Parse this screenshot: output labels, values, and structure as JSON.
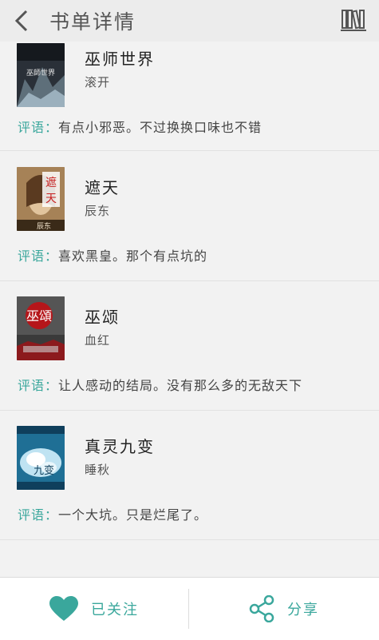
{
  "header": {
    "title": "书单详情"
  },
  "books": [
    {
      "title": "巫师世界",
      "author": "滚开",
      "review_label": "评语：",
      "review": "有点小邪恶。不过换换口味也不错",
      "cover_text": "巫師世界"
    },
    {
      "title": "遮天",
      "author": "辰东",
      "review_label": "评语：",
      "review": "喜欢黑皇。那个有点坑的",
      "cover_text": "遮天"
    },
    {
      "title": "巫颂",
      "author": "血红",
      "review_label": "评语：",
      "review": "让人感动的结局。没有那么多的无敌天下",
      "cover_text": "巫頌"
    },
    {
      "title": "真灵九变",
      "author": "睡秋",
      "review_label": "评语：",
      "review": "一个大坑。只是烂尾了。",
      "cover_text": "九变"
    }
  ],
  "bottom": {
    "follow_label": "已关注",
    "share_label": "分享"
  },
  "colors": {
    "accent": "#3aa79c"
  },
  "icons": {
    "back": "chevron-left",
    "bookshelf": "bookshelf",
    "follow": "heart",
    "share": "share-nodes"
  }
}
